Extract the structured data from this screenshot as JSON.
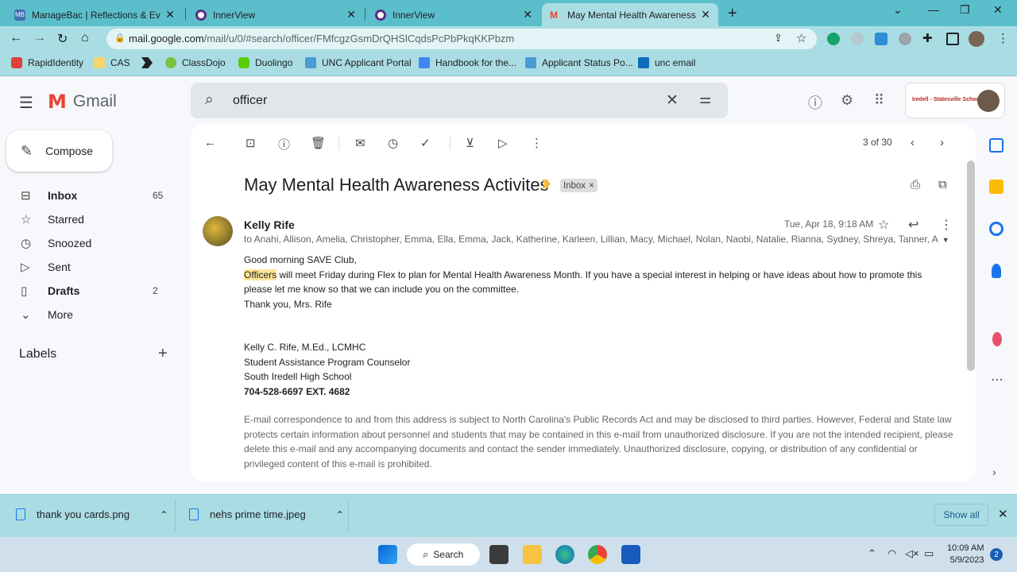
{
  "browser": {
    "tabs": [
      {
        "title": "ManageBac | Reflections & Evide",
        "active": false
      },
      {
        "title": "InnerView",
        "active": false
      },
      {
        "title": "InnerView",
        "active": false
      },
      {
        "title": "May Mental Health Awareness Ac",
        "active": true
      }
    ],
    "url_domain": "mail.google.com",
    "url_path": "/mail/u/0/#search/officer/FMfcgzGsmDrQHSlCqdsPcPbPkqKKPbzm",
    "bookmarks": [
      "RapidIdentity",
      "CAS",
      "",
      "ClassDojo",
      "Duolingo",
      "UNC Applicant Portal",
      "Handbook for the...",
      "Applicant Status Po...",
      "unc email"
    ]
  },
  "gmail": {
    "app_name": "Gmail",
    "search_value": "officer",
    "account_org": "Iredell - Statesville Schools"
  },
  "sidebar": {
    "compose_label": "Compose",
    "items": [
      {
        "label": "Inbox",
        "count": "65",
        "bold": true,
        "icon": "inbox-icon"
      },
      {
        "label": "Starred",
        "count": "",
        "bold": false,
        "icon": "star-icon"
      },
      {
        "label": "Snoozed",
        "count": "",
        "bold": false,
        "icon": "clock-icon"
      },
      {
        "label": "Sent",
        "count": "",
        "bold": false,
        "icon": "send-icon"
      },
      {
        "label": "Drafts",
        "count": "2",
        "bold": true,
        "icon": "file-icon"
      },
      {
        "label": "More",
        "count": "",
        "bold": false,
        "icon": "chevron-down-icon"
      }
    ],
    "labels_heading": "Labels"
  },
  "toolbar": {
    "pager": "3 of 30"
  },
  "email": {
    "subject": "May Mental Health Awareness Activites",
    "badge": "Inbox",
    "sender": "Kelly Rife",
    "recipients": "to Anahi, Allison, Amelia, Christopher, Emma, Ella, Emma, Jack, Katherine, Karleen, Lillian, Macy, Michael, Nolan, Naobi, Natalie, Rianna, Sydney, Shreya, Tanner, A",
    "date": "Tue, Apr 18, 9:18 AM",
    "greeting": "Good morning SAVE Club,",
    "highlight": "Officers",
    "line1_rest": " will meet Friday during Flex to plan for Mental Health Awareness Month.  If you have a special interest in helping or have ideas about how to promote this",
    "line2": "please let me know so that we can include you on the committee.",
    "thanks": "Thank you, Mrs. Rife",
    "sig_name": "Kelly C. Rife, M.Ed., LCMHC",
    "sig_title": "Student Assistance Program Counselor",
    "sig_school": "South Iredell High School",
    "sig_phone": "704-528-6697 EXT. 4682",
    "disclaimer": "E-mail correspondence to and from this address is subject to North Carolina's Public Records Act and may be disclosed to third parties. However, Federal and State law protects certain information about personnel and students that may be contained in this e-mail from unauthorized disclosure. If you are not the intended recipient, please delete this e-mail and any accompanying documents and contact the sender immediately. Unauthorized disclosure, copying, or distribution of any confidential or privileged content of this e-mail is prohibited."
  },
  "downloads": {
    "items": [
      "thank you cards.png",
      "nehs prime time.jpeg"
    ],
    "show_all": "Show all"
  },
  "taskbar": {
    "search_label": "Search",
    "time": "10:09 AM",
    "date": "5/9/2023",
    "notifications": "2"
  },
  "colors": {
    "chrome_frame": "#5bbfcb",
    "chrome_toolbar": "#a9dde3",
    "gmail_red": "#ea4335",
    "highlight": "#fce49a"
  }
}
